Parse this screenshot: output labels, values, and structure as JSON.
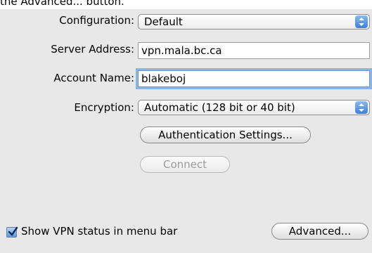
{
  "caption": "the Advanced... button.",
  "configuration": {
    "label": "Configuration:",
    "value": "Default"
  },
  "server_address": {
    "label": "Server Address:",
    "value": "vpn.mala.bc.ca"
  },
  "account_name": {
    "label": "Account Name:",
    "value": "blakeboj"
  },
  "encryption": {
    "label": "Encryption:",
    "value": "Automatic (128 bit or 40 bit)"
  },
  "buttons": {
    "authentication": "Authentication Settings...",
    "connect": "Connect",
    "advanced": "Advanced..."
  },
  "show_status": {
    "label": "Show VPN status in menu bar",
    "checked": true
  },
  "colors": {
    "accent": "#3d7fd8",
    "focus_ring": "#8db3e6",
    "panel": "#e8e8e8"
  }
}
